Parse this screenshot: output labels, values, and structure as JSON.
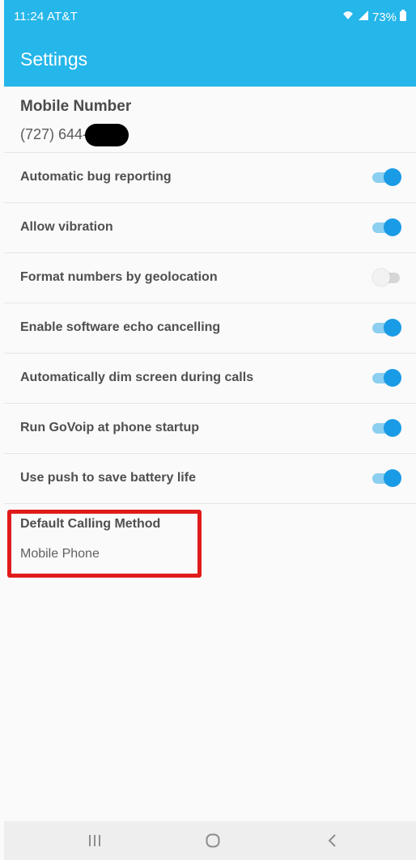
{
  "statusbar": {
    "time_carrier": "11:24 AT&T",
    "battery": "73%"
  },
  "appbar": {
    "title": "Settings"
  },
  "mobile_number": {
    "label": "Mobile Number",
    "value_prefix": "(727) 644-"
  },
  "settings": [
    {
      "label": "Automatic bug reporting",
      "enabled": true
    },
    {
      "label": "Allow vibration",
      "enabled": true
    },
    {
      "label": "Format numbers by geolocation",
      "enabled": false
    },
    {
      "label": "Enable software echo cancelling",
      "enabled": true
    },
    {
      "label": "Automatically dim screen during calls",
      "enabled": true
    },
    {
      "label": "Run GoVoip at phone startup",
      "enabled": true
    },
    {
      "label": "Use push to save battery life",
      "enabled": true
    }
  ],
  "default_calling": {
    "title": "Default Calling Method",
    "value": "Mobile Phone"
  },
  "colors": {
    "header": "#25b6ea",
    "toggle_on": "#1a9be6",
    "highlight": "#e11b1b"
  },
  "icons": {
    "wifi": "wifi-icon",
    "signal": "signal-icon",
    "battery": "battery-icon",
    "recent_apps": "recent-apps-icon",
    "home": "home-icon",
    "back": "back-icon"
  }
}
